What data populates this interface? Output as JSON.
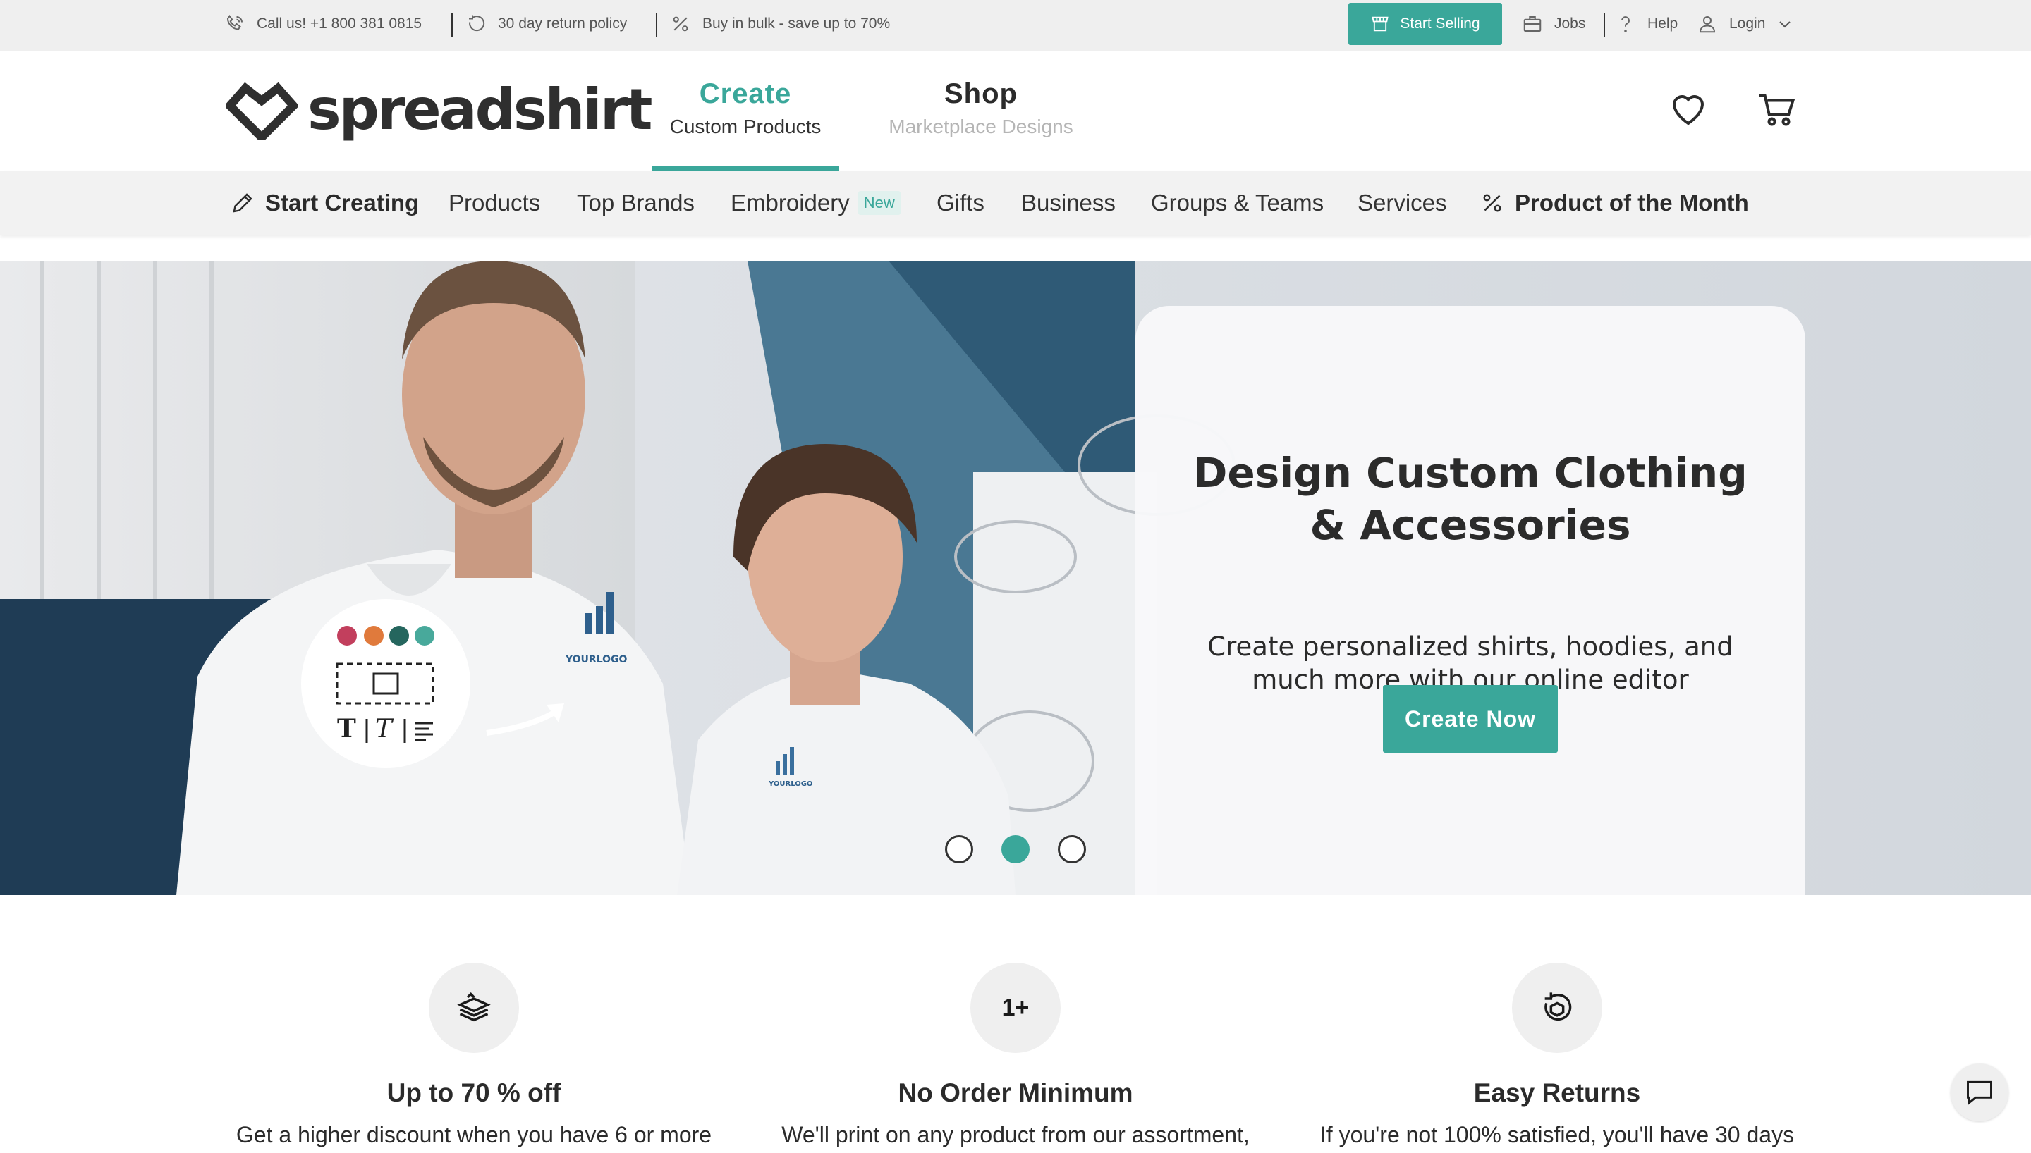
{
  "topbar": {
    "call": "Call us! +1 800 381 0815",
    "returns": "30 day return policy",
    "bulk": "Buy in bulk - save up to 70%",
    "start_selling": "Start Selling",
    "jobs": "Jobs",
    "help": "Help",
    "login": "Login"
  },
  "header": {
    "logo_text": "spreadshirt",
    "tabs": [
      {
        "label": "Create",
        "sublabel": "Custom Products",
        "active": true
      },
      {
        "label": "Shop",
        "sublabel": "Marketplace Designs",
        "active": false
      }
    ],
    "icons": [
      "heart-icon",
      "cart-icon"
    ]
  },
  "nav": {
    "start_creating": "Start Creating",
    "products": "Products",
    "top_brands": "Top Brands",
    "embroidery": "Embroidery",
    "embroidery_badge": "New",
    "gifts": "Gifts",
    "business": "Business",
    "groups_teams": "Groups & Teams",
    "services": "Services",
    "product_of_month": "Product of the Month"
  },
  "hero": {
    "title": "Design Custom Clothing & Accessories",
    "subtitle": "Create personalized shirts, hoodies, and much more with our online editor",
    "cta": "Create Now",
    "logo_text": "YOURLOGO",
    "active_slide": 2,
    "slide_count": 3
  },
  "features": [
    {
      "icon": "stack-discount-icon",
      "circle_text": "",
      "title": "Up to 70 % off",
      "text": "Get a higher discount when you have 6 or more"
    },
    {
      "icon": "one-plus-icon",
      "circle_text": "1+",
      "title": "No Order Minimum",
      "text": "We'll print on any product from our assortment,"
    },
    {
      "icon": "return-box-icon",
      "circle_text": "",
      "title": "Easy Returns",
      "text": "If you're not 100% satisfied, you'll have 30 days"
    }
  ],
  "colors": {
    "accent": "#3aa79a",
    "topbar_bg": "#efefef",
    "nav_bg": "#f2f2f2",
    "text": "#2b2b2b"
  }
}
